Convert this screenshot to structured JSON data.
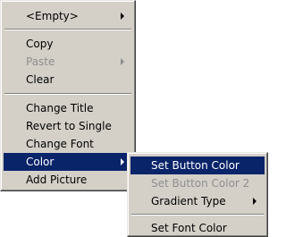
{
  "main_menu": {
    "items": [
      {
        "label": "<Empty>",
        "state": "normal",
        "has_submenu": true
      },
      {
        "label": "Copy",
        "state": "normal",
        "has_submenu": false
      },
      {
        "label": "Paste",
        "state": "disabled",
        "has_submenu": true
      },
      {
        "label": "Clear",
        "state": "normal",
        "has_submenu": false
      },
      {
        "label": "Change Title",
        "state": "normal",
        "has_submenu": false
      },
      {
        "label": "Revert to Single",
        "state": "normal",
        "has_submenu": false
      },
      {
        "label": "Change Font",
        "state": "normal",
        "has_submenu": false
      },
      {
        "label": "Color",
        "state": "selected",
        "has_submenu": true
      },
      {
        "label": "Add Picture",
        "state": "normal",
        "has_submenu": false
      }
    ]
  },
  "color_submenu": {
    "items": [
      {
        "label": "Set Button Color",
        "state": "selected",
        "has_submenu": false
      },
      {
        "label": "Set Button Color 2",
        "state": "disabled",
        "has_submenu": false
      },
      {
        "label": "Gradient Type",
        "state": "normal",
        "has_submenu": true
      },
      {
        "label": "Set Font Color",
        "state": "normal",
        "has_submenu": false
      }
    ]
  },
  "colors": {
    "menu_background": "#d4d0c8",
    "highlight": "#0a246a",
    "highlight_text": "#ffffff",
    "disabled_text": "#8e8e8e"
  }
}
